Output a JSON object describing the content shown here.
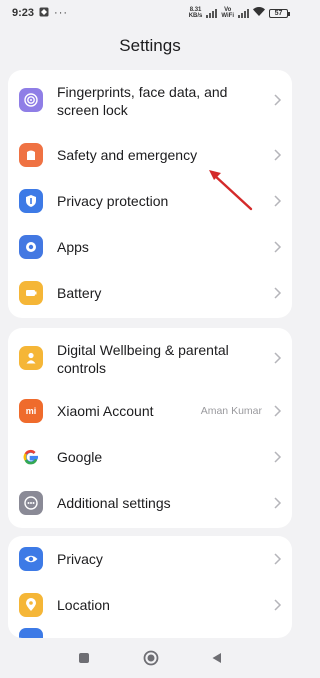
{
  "status_bar": {
    "time": "9:23",
    "dots": "···",
    "speed_value": "8.31",
    "speed_unit": "KB/s",
    "volte_top": "Vo",
    "volte_bottom": "WiFi",
    "battery": "57"
  },
  "header": {
    "title": "Settings"
  },
  "groups": [
    {
      "items": [
        {
          "label_line1": "Fingerprints, face data, and",
          "label_line2": "screen lock",
          "icon": "fingerprint-icon",
          "color": "#8f7ee6"
        },
        {
          "label": "Safety and emergency",
          "icon": "shield-icon",
          "color": "#ef7243"
        },
        {
          "label": "Privacy protection",
          "icon": "privacy-shield-icon",
          "color": "#3d7ae6"
        },
        {
          "label": "Apps",
          "icon": "gear-icon",
          "color": "#4378e2"
        },
        {
          "label": "Battery",
          "icon": "battery-icon",
          "color": "#f5b637"
        }
      ]
    },
    {
      "items": [
        {
          "label_line1": "Digital Wellbeing & parental",
          "label_line2": "controls",
          "icon": "person-icon",
          "color": "#f5b637"
        },
        {
          "label": "Xiaomi Account",
          "value": "Aman Kumar",
          "icon": "mi-icon",
          "color": "#ef6b2c"
        },
        {
          "label": "Google",
          "icon": "google-icon",
          "color": "#ffffff"
        },
        {
          "label": "Additional settings",
          "icon": "more-icon",
          "color": "#8a8a96"
        }
      ]
    },
    {
      "items": [
        {
          "label": "Privacy",
          "icon": "eye-icon",
          "color": "#3d7ae6"
        },
        {
          "label": "Location",
          "icon": "location-pin-icon",
          "color": "#f5b637"
        }
      ]
    }
  ],
  "nav": {
    "recent": "square-icon",
    "home": "circle-icon",
    "back": "triangle-icon"
  },
  "annotation": {
    "color": "#d42a2a"
  }
}
